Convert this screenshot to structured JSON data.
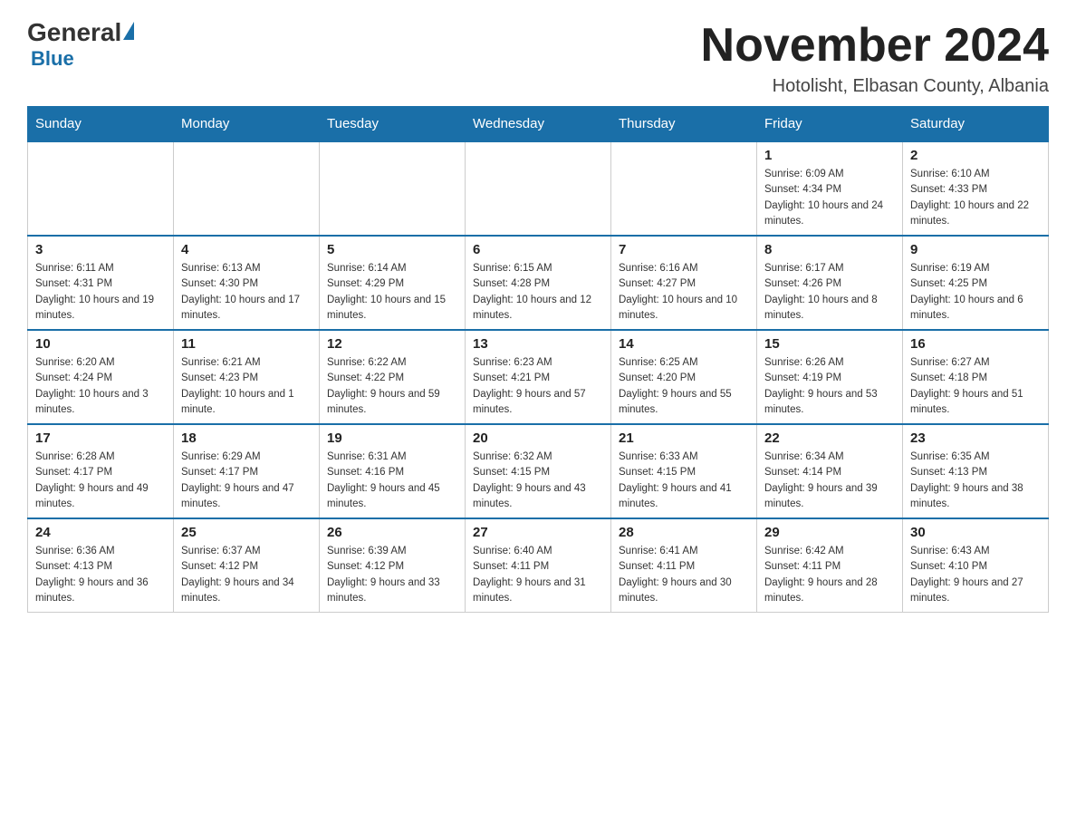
{
  "header": {
    "logo_general": "General",
    "logo_blue": "Blue",
    "month_title": "November 2024",
    "location": "Hotolisht, Elbasan County, Albania"
  },
  "weekdays": [
    "Sunday",
    "Monday",
    "Tuesday",
    "Wednesday",
    "Thursday",
    "Friday",
    "Saturday"
  ],
  "weeks": [
    [
      {
        "day": "",
        "info": ""
      },
      {
        "day": "",
        "info": ""
      },
      {
        "day": "",
        "info": ""
      },
      {
        "day": "",
        "info": ""
      },
      {
        "day": "",
        "info": ""
      },
      {
        "day": "1",
        "info": "Sunrise: 6:09 AM\nSunset: 4:34 PM\nDaylight: 10 hours and 24 minutes."
      },
      {
        "day": "2",
        "info": "Sunrise: 6:10 AM\nSunset: 4:33 PM\nDaylight: 10 hours and 22 minutes."
      }
    ],
    [
      {
        "day": "3",
        "info": "Sunrise: 6:11 AM\nSunset: 4:31 PM\nDaylight: 10 hours and 19 minutes."
      },
      {
        "day": "4",
        "info": "Sunrise: 6:13 AM\nSunset: 4:30 PM\nDaylight: 10 hours and 17 minutes."
      },
      {
        "day": "5",
        "info": "Sunrise: 6:14 AM\nSunset: 4:29 PM\nDaylight: 10 hours and 15 minutes."
      },
      {
        "day": "6",
        "info": "Sunrise: 6:15 AM\nSunset: 4:28 PM\nDaylight: 10 hours and 12 minutes."
      },
      {
        "day": "7",
        "info": "Sunrise: 6:16 AM\nSunset: 4:27 PM\nDaylight: 10 hours and 10 minutes."
      },
      {
        "day": "8",
        "info": "Sunrise: 6:17 AM\nSunset: 4:26 PM\nDaylight: 10 hours and 8 minutes."
      },
      {
        "day": "9",
        "info": "Sunrise: 6:19 AM\nSunset: 4:25 PM\nDaylight: 10 hours and 6 minutes."
      }
    ],
    [
      {
        "day": "10",
        "info": "Sunrise: 6:20 AM\nSunset: 4:24 PM\nDaylight: 10 hours and 3 minutes."
      },
      {
        "day": "11",
        "info": "Sunrise: 6:21 AM\nSunset: 4:23 PM\nDaylight: 10 hours and 1 minute."
      },
      {
        "day": "12",
        "info": "Sunrise: 6:22 AM\nSunset: 4:22 PM\nDaylight: 9 hours and 59 minutes."
      },
      {
        "day": "13",
        "info": "Sunrise: 6:23 AM\nSunset: 4:21 PM\nDaylight: 9 hours and 57 minutes."
      },
      {
        "day": "14",
        "info": "Sunrise: 6:25 AM\nSunset: 4:20 PM\nDaylight: 9 hours and 55 minutes."
      },
      {
        "day": "15",
        "info": "Sunrise: 6:26 AM\nSunset: 4:19 PM\nDaylight: 9 hours and 53 minutes."
      },
      {
        "day": "16",
        "info": "Sunrise: 6:27 AM\nSunset: 4:18 PM\nDaylight: 9 hours and 51 minutes."
      }
    ],
    [
      {
        "day": "17",
        "info": "Sunrise: 6:28 AM\nSunset: 4:17 PM\nDaylight: 9 hours and 49 minutes."
      },
      {
        "day": "18",
        "info": "Sunrise: 6:29 AM\nSunset: 4:17 PM\nDaylight: 9 hours and 47 minutes."
      },
      {
        "day": "19",
        "info": "Sunrise: 6:31 AM\nSunset: 4:16 PM\nDaylight: 9 hours and 45 minutes."
      },
      {
        "day": "20",
        "info": "Sunrise: 6:32 AM\nSunset: 4:15 PM\nDaylight: 9 hours and 43 minutes."
      },
      {
        "day": "21",
        "info": "Sunrise: 6:33 AM\nSunset: 4:15 PM\nDaylight: 9 hours and 41 minutes."
      },
      {
        "day": "22",
        "info": "Sunrise: 6:34 AM\nSunset: 4:14 PM\nDaylight: 9 hours and 39 minutes."
      },
      {
        "day": "23",
        "info": "Sunrise: 6:35 AM\nSunset: 4:13 PM\nDaylight: 9 hours and 38 minutes."
      }
    ],
    [
      {
        "day": "24",
        "info": "Sunrise: 6:36 AM\nSunset: 4:13 PM\nDaylight: 9 hours and 36 minutes."
      },
      {
        "day": "25",
        "info": "Sunrise: 6:37 AM\nSunset: 4:12 PM\nDaylight: 9 hours and 34 minutes."
      },
      {
        "day": "26",
        "info": "Sunrise: 6:39 AM\nSunset: 4:12 PM\nDaylight: 9 hours and 33 minutes."
      },
      {
        "day": "27",
        "info": "Sunrise: 6:40 AM\nSunset: 4:11 PM\nDaylight: 9 hours and 31 minutes."
      },
      {
        "day": "28",
        "info": "Sunrise: 6:41 AM\nSunset: 4:11 PM\nDaylight: 9 hours and 30 minutes."
      },
      {
        "day": "29",
        "info": "Sunrise: 6:42 AM\nSunset: 4:11 PM\nDaylight: 9 hours and 28 minutes."
      },
      {
        "day": "30",
        "info": "Sunrise: 6:43 AM\nSunset: 4:10 PM\nDaylight: 9 hours and 27 minutes."
      }
    ]
  ]
}
